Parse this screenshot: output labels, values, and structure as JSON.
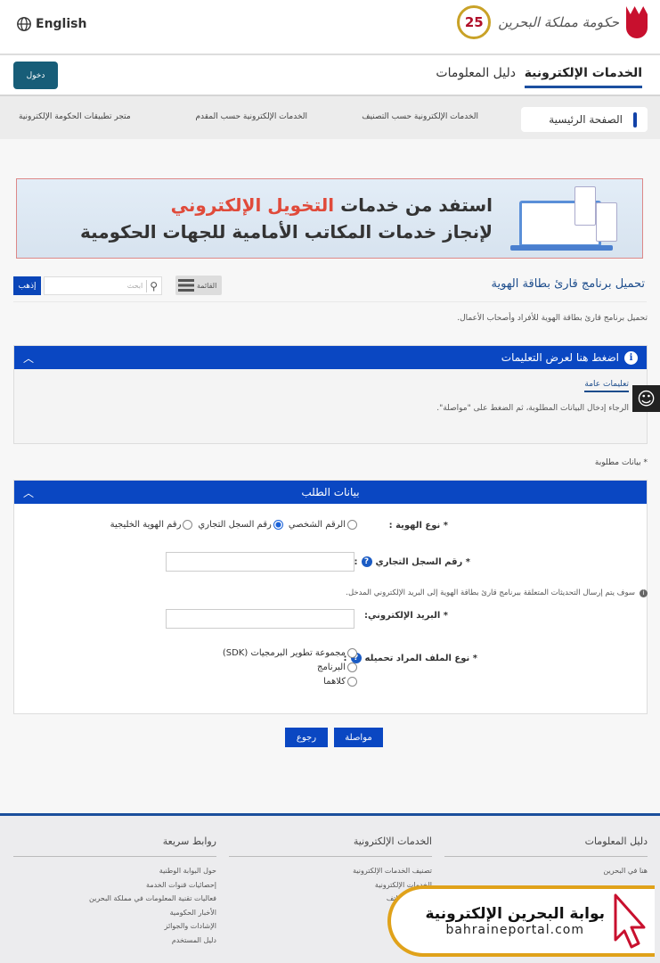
{
  "header": {
    "language": "English",
    "logo_text": "حكومة مملكة البحرين",
    "anniversary": "25"
  },
  "nav": {
    "login": "دخول",
    "tabs": [
      "الخدمات الإلكترونية",
      "دليل المعلومات"
    ]
  },
  "subnav": {
    "items": [
      "الصفحة الرئيسية",
      "الخدمات الإلكترونية حسب التصنيف",
      "الخدمات الإلكترونية حسب المقدم",
      "متجر تطبيقات الحكومة الإلكترونية"
    ]
  },
  "banner": {
    "line1_prefix": "استفد من خدمات ",
    "line1_highlight": "التخويل الإلكتروني",
    "line2": "لإنجاز خدمات المكاتب الأمامية للجهات الحكومية",
    "highlight_color": "#e04a3a"
  },
  "page": {
    "title": "تحميل برنامج قارئ بطاقة الهوية",
    "menu": "القائمة",
    "search_placeholder": "ابحث",
    "go": "إذهب",
    "description": "تحميل برنامج قارئ بطاقة الهوية للأفراد وأصحاب الأعمال."
  },
  "instructions": {
    "header": "اضغط هنا لعرض التعليمات",
    "tab": "تعليمات عامة",
    "text": "الرجاء إدخال البيانات المطلوبة، ثم الضغط على \"مواصلة\"."
  },
  "required_note": "* بيانات مطلوبة",
  "form": {
    "header": "بيانات الطلب",
    "id_type_label": "* نوع الهوية :",
    "id_types": [
      "الرقم الشخصي",
      "رقم السجل التجاري",
      "رقم الهوية الخليجية"
    ],
    "id_type_selected": "رقم السجل التجاري",
    "cr_label": "* رقم السجل التجاري",
    "cr_value": "",
    "note": "سوف يتم إرسال التحديثات المتعلقة ببرنامج قارئ بطاقة الهوية إلى البريد الإلكتروني المدخل.",
    "email_label": "* البريد الإلكتروني:",
    "email_value": "",
    "file_label": "* نوع الملف المراد تحميله",
    "file_types": [
      "مجموعة تطوير البرمجيات (SDK)",
      "البرنامج",
      "كلاهما"
    ],
    "continue": "مواصلة",
    "back": "رجوع"
  },
  "footer": {
    "columns": [
      {
        "title": "دليل المعلومات",
        "links": [
          "هنا في البحرين"
        ]
      },
      {
        "title": "الخدمات الإلكترونية",
        "links": [
          "تصنيف الخدمات الإلكترونية",
          "الخدمات الإلكترونية",
          "خدمات الهواتف"
        ]
      },
      {
        "title": "روابط سريعة",
        "links": [
          "حول البوابة الوطنية",
          "إحصائيات قنوات الخدمة",
          "فعاليات تقنية المعلومات في مملكة البحرين",
          "الأخبار الحكومية",
          "الإشادات والجوائز",
          "دليل المستخدم"
        ]
      }
    ]
  },
  "watermark": {
    "arabic": "بوابة البحرين الإلكترونية",
    "url": "bahraineportal.com"
  },
  "colors": {
    "primary_blue": "#0a47c2",
    "login_teal": "#175d78",
    "footer_line": "#1b4f9c"
  }
}
